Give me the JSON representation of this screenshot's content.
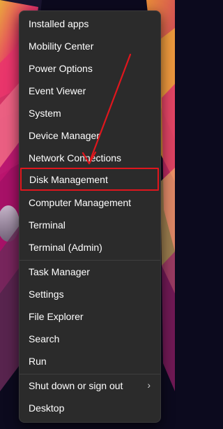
{
  "menu": {
    "items": [
      {
        "label": "Installed apps"
      },
      {
        "label": "Mobility Center"
      },
      {
        "label": "Power Options"
      },
      {
        "label": "Event Viewer"
      },
      {
        "label": "System"
      },
      {
        "label": "Device Manager"
      },
      {
        "label": "Network Connections"
      },
      {
        "label": "Disk Management"
      },
      {
        "label": "Computer Management"
      },
      {
        "label": "Terminal"
      },
      {
        "label": "Terminal (Admin)"
      },
      {
        "label": "Task Manager"
      },
      {
        "label": "Settings"
      },
      {
        "label": "File Explorer"
      },
      {
        "label": "Search"
      },
      {
        "label": "Run"
      },
      {
        "label": "Shut down or sign out",
        "has_submenu": true
      },
      {
        "label": "Desktop"
      }
    ],
    "highlighted_item": "Disk Management"
  },
  "colors": {
    "menu_background": "#2b2b2b",
    "menu_text": "#ffffff",
    "annotation_red": "#e0161d",
    "separator": "#3e3e3e"
  },
  "icons": {
    "submenu": "chevron-right-icon"
  }
}
